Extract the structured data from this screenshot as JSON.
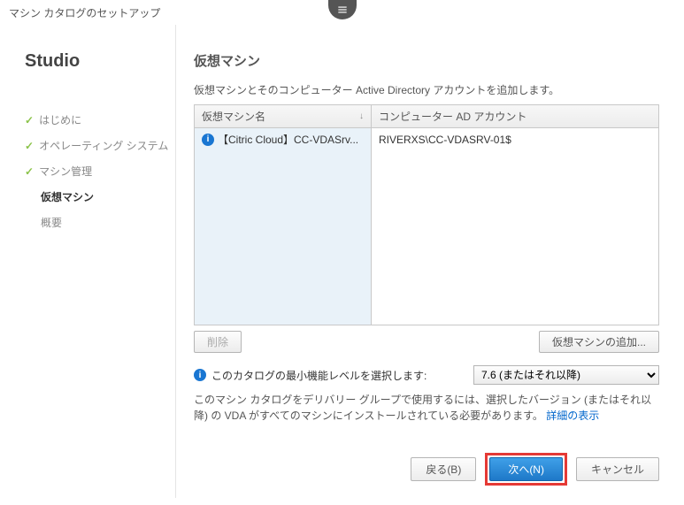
{
  "title": "マシン カタログのセットアップ",
  "studio": "Studio",
  "nav": {
    "items": [
      {
        "label": "はじめに"
      },
      {
        "label": "オペレーティング システム"
      },
      {
        "label": "マシン管理"
      },
      {
        "label": "仮想マシン"
      },
      {
        "label": "概要"
      }
    ]
  },
  "heading": "仮想マシン",
  "description": "仮想マシンとそのコンピューター Active Directory アカウントを追加します。",
  "table": {
    "col1": "仮想マシン名",
    "col2": "コンピューター AD アカウント",
    "rows": [
      {
        "name": "【Citric Cloud】CC-VDASrv...",
        "account": "RIVERXS\\CC-VDASRV-01$"
      }
    ]
  },
  "buttons": {
    "delete": "削除",
    "addvm": "仮想マシンの追加...",
    "back": "戻る(B)",
    "next": "次へ(N)",
    "cancel": "キャンセル"
  },
  "level": {
    "label": "このカタログの最小機能レベルを選択します:",
    "selected": "7.6 (またはそれ以降)"
  },
  "note_text": "このマシン カタログをデリバリー グループで使用するには、選択したバージョン (またはそれ以降) の VDA がすべてのマシンにインストールされている必要があります。",
  "note_link": "詳細の表示"
}
